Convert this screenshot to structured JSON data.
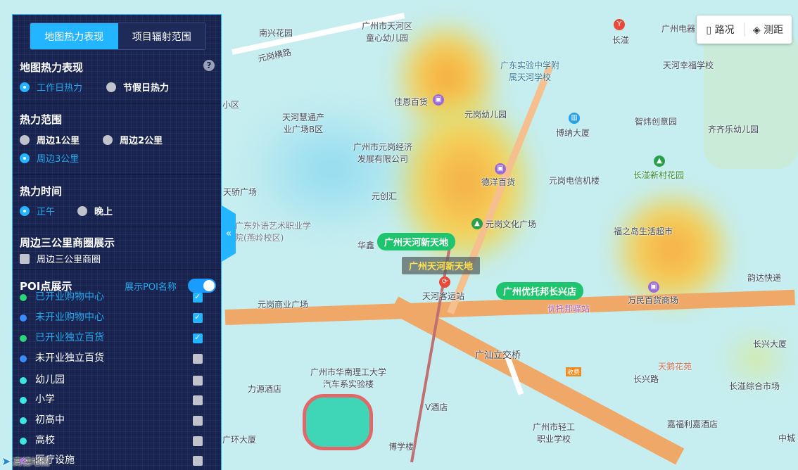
{
  "panel": {
    "tabs": [
      {
        "label": "地图热力表现",
        "active": true
      },
      {
        "label": "项目辐射范围",
        "active": false
      }
    ],
    "heat_mode": {
      "title": "地图热力表现",
      "help_icon": "question-circle-icon",
      "options": [
        "工作日热力",
        "节假日热力"
      ],
      "selected": 0
    },
    "heat_range": {
      "title": "热力范围",
      "options": [
        "周边1公里",
        "周边2公里",
        "周边3公里"
      ],
      "selected": 2
    },
    "heat_time": {
      "title": "热力时间",
      "options": [
        "正午",
        "晚上"
      ],
      "selected": 0
    },
    "business": {
      "title": "周边三公里商圈展示",
      "checkbox_label": "周边三公里商圈",
      "checked": false
    },
    "poi": {
      "title": "POI点展示",
      "toggle_label": "展示POI名称",
      "toggle_on": true,
      "items": [
        {
          "label": "已开业购物中心",
          "color": "#2ed47a",
          "checked": true
        },
        {
          "label": "未开业购物中心",
          "color": "#3b8cff",
          "checked": true
        },
        {
          "label": "已开业独立百货",
          "color": "#2ed47a",
          "checked": true
        },
        {
          "label": "未开业独立百货",
          "color": "#3b8cff",
          "checked": false
        },
        {
          "label": "幼儿园",
          "color": "#3de6e0",
          "checked": false
        },
        {
          "label": "小学",
          "color": "#3de6e0",
          "checked": false
        },
        {
          "label": "初高中",
          "color": "#3de6e0",
          "checked": false
        },
        {
          "label": "高校",
          "color": "#3de6e0",
          "checked": false
        },
        {
          "label": "医疗设施",
          "color": "#a040f0",
          "checked": false
        }
      ]
    }
  },
  "map_controls": {
    "traffic": "路况",
    "measure": "测距"
  },
  "map_labels": [
    "南兴花园",
    "广州市天河区童心幼儿园",
    "长湴",
    "广州电器",
    "广东实验中学附属天河学校",
    "天河幸福学校",
    "佳恩百货",
    "元岗幼儿园",
    "天河慧通产业广场B区",
    "博纳大厦",
    "智炜创意园",
    "齐齐乐幼儿园",
    "广州市元岗经济发展有限公司",
    "德洋百货",
    "元岗电信机楼",
    "长湴新村花园",
    "天骄广场",
    "元创汇",
    "广东外语艺术职业学院(燕岭校区)",
    "华鑫",
    "元岗文化广场",
    "福之岛生活超市",
    "韵达快递",
    "天河客运站",
    "万民百货商场",
    "元岗商业广场",
    "优托邦驿站",
    "长兴大厦",
    "广汕立交桥",
    "天鹅花苑",
    "长兴路",
    "广州市华南理工大学汽车系实验楼",
    "力源酒店",
    "V酒店",
    "长湴综合市场",
    "嘉福利嘉酒店",
    "广环大厦",
    "博学楼",
    "广州市轻工职业学校",
    "中城",
    "元岗横路",
    "小区",
    "收费"
  ],
  "map_tags": [
    "广州天河新天地",
    "广州天河新天地",
    "广州优托邦长兴店"
  ],
  "attribution": "高德地图",
  "colors": {
    "accent": "#23b5ff",
    "panel_bg": "#18244f",
    "tag_green": "#1fc46e"
  }
}
